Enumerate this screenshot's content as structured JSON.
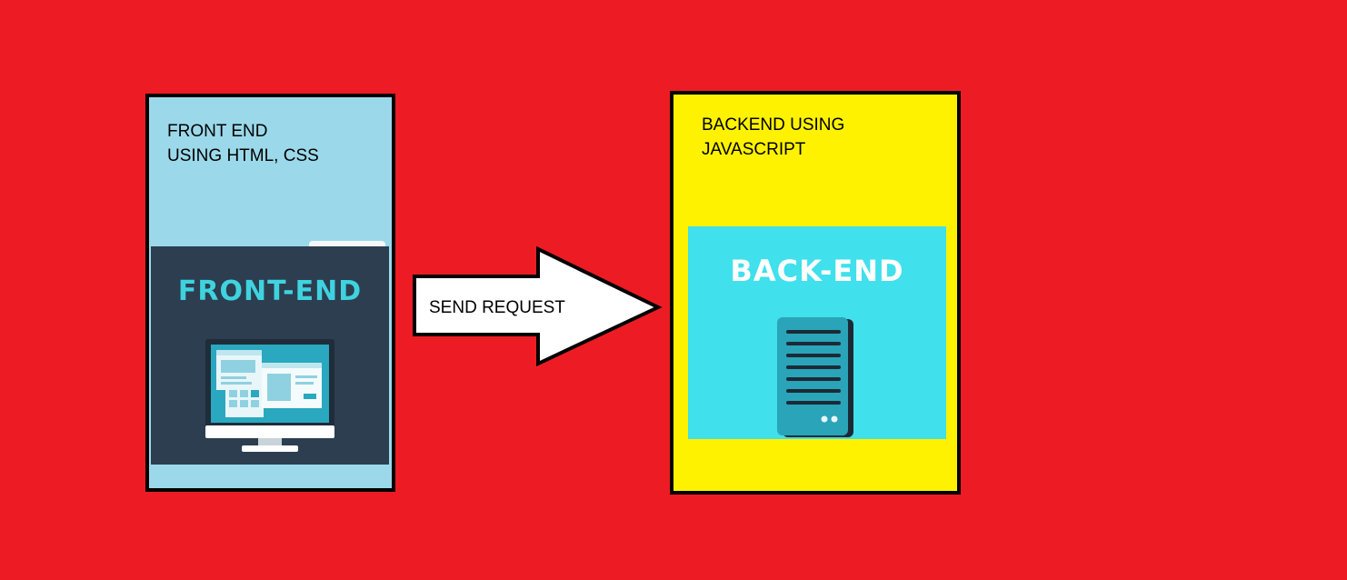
{
  "frontend": {
    "label_lines": [
      "FRONT END",
      "USING HTML, CSS"
    ],
    "tile_title": "FRONT-END",
    "icon": "monitor-icon"
  },
  "backend": {
    "label_lines": [
      "BACKEND USING",
      "JAVASCRIPT"
    ],
    "tile_title": "BACK-END",
    "icon": "server-icon"
  },
  "arrow": {
    "label": "SEND REQUEST"
  },
  "colors": {
    "background": "#ed1c24",
    "frontend_box": "#9bd9ea",
    "backend_box": "#fff200",
    "frontend_tile": "#2c3e50",
    "frontend_title": "#3fd3df",
    "backend_tile": "#40e0ec",
    "backend_title": "#ffffff",
    "border": "#000000",
    "arrow_fill": "#ffffff"
  }
}
